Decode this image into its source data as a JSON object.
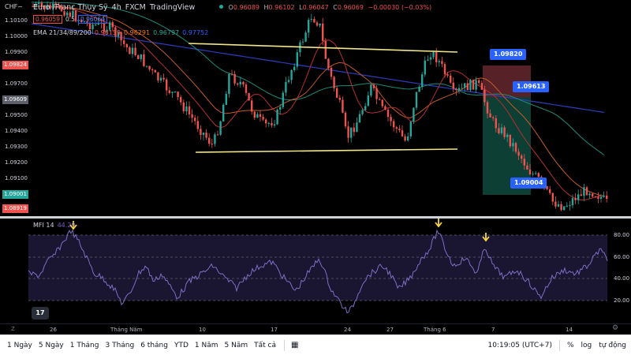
{
  "header": {
    "symbol_badge": "CHF~",
    "title_parts": [
      "Euro /Franc Thụy Sỹ",
      "4h",
      "FXCM",
      "TradingView"
    ],
    "ohlc": [
      {
        "label": "O",
        "value": "0.96089"
      },
      {
        "label": "H",
        "value": "0.96102"
      },
      {
        "label": "L",
        "value": "0.96047"
      },
      {
        "label": "C",
        "value": "0.96069"
      },
      {
        "label": "",
        "value": "−0.00030 (−0.03%)"
      }
    ],
    "bid": "0.96059",
    "spread": "0.5",
    "ask": "0.96064",
    "ema_label": "EMA 21/34/89/200",
    "ema_values": [
      "0.96159",
      "0.96291",
      "0.96797",
      "0.97752"
    ]
  },
  "price_axis": {
    "ticks": [
      "1.10100",
      "1.10000",
      "1.09900",
      "1.09700",
      "1.09500",
      "1.09400",
      "1.09300",
      "1.09200",
      "1.09100",
      "1.09000"
    ],
    "tags": [
      {
        "text": "1.09824",
        "color": "#ef5350"
      },
      {
        "text": "1.09609",
        "color": "#5d606b"
      },
      {
        "text": "1.09001",
        "color": "#26a69a"
      },
      {
        "text": "1.08919",
        "color": "#ef5350"
      }
    ]
  },
  "callouts": [
    "1.09820",
    "1.09613",
    "1.09004"
  ],
  "mfi": {
    "label": "MFI 14",
    "value": "44.29",
    "ticks": [
      "80.00",
      "60.00",
      "40.00",
      "20.00"
    ]
  },
  "time_axis": {
    "labels": [
      "26",
      "Tháng Năm",
      "10",
      "17",
      "24",
      "27",
      "Tháng 6",
      "7",
      "14"
    ]
  },
  "bottom_bar": {
    "ranges": [
      "1 Ngày",
      "5 Ngày",
      "1 Tháng",
      "3 Tháng",
      "6 tháng",
      "YTD",
      "1 Năm",
      "5 Năm",
      "Tất cả"
    ],
    "clock": "10:19:05 (UTC+7)",
    "percent": "%",
    "log": "log",
    "auto": "tự động"
  },
  "icons": {
    "logo": "tradingview-logo-icon",
    "z": "zoom-reset-icon",
    "gear": "gear-icon",
    "calendar": "calendar-icon"
  },
  "colors": {
    "bull": "#26a69a",
    "bear": "#ef5350",
    "trendline": "#f0e68c",
    "mfi_line": "#7e6fc4"
  }
}
